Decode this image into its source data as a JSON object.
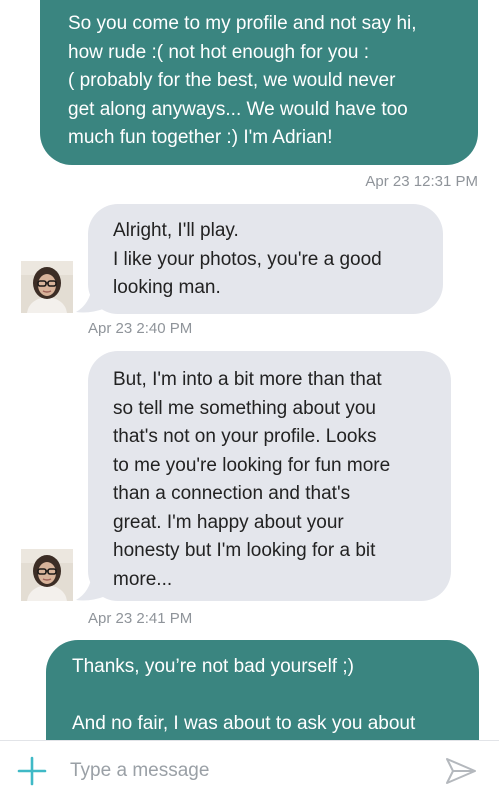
{
  "colors": {
    "outgoing_bubble": "#3a8580",
    "incoming_bubble": "#e4e6ec",
    "timestamp": "#8f949a",
    "accent_plus": "#3fb9c6"
  },
  "conversation": {
    "messages": [
      {
        "direction": "outgoing",
        "text": "So you come to my profile and not say hi,\nhow rude :( not hot enough for you :\n( probably for the best, we would never\nget along anyways... We would have too\nmuch fun together :) I'm Adrian!",
        "timestamp": "Apr 23 12:31 PM"
      },
      {
        "direction": "incoming",
        "text": "Alright, I'll play.\nI like your photos,  you're a good\nlooking man.",
        "timestamp": "Apr 23 2:40 PM",
        "avatar": "user-avatar"
      },
      {
        "direction": "incoming",
        "text": "But, I'm into a bit more than that\nso tell me something about you\nthat's not on your profile.  Looks\nto me you're looking for fun more\nthan a connection and that's\ngreat.  I'm happy about your\nhonesty but I'm looking for a bit\nmore...",
        "timestamp": "Apr 23 2:41 PM",
        "avatar": "user-avatar"
      },
      {
        "direction": "outgoing",
        "text": "Thanks, you’re not bad yourself ;)\n\nAnd no fair, I was about to ask you about",
        "timestamp": ""
      }
    ]
  },
  "composer": {
    "add_icon": "plus-icon",
    "placeholder": "Type a message",
    "value": "",
    "send_icon": "paper-plane-icon"
  }
}
